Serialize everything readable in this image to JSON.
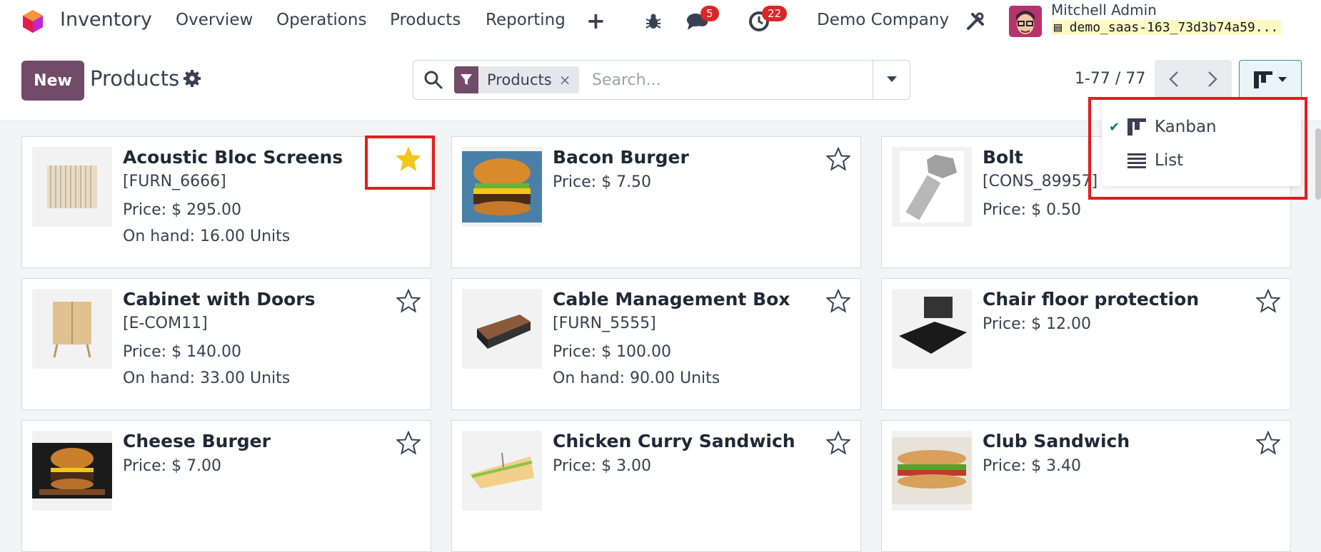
{
  "navbar": {
    "app_name": "Inventory",
    "menus": [
      "Overview",
      "Operations",
      "Products",
      "Reporting"
    ],
    "messages_count": "5",
    "activities_count": "22",
    "company": "Demo Company",
    "user_name": "Mitchell Admin",
    "database": "demo_saas-163_73d3b74a59..."
  },
  "control": {
    "new_label": "New",
    "title": "Products",
    "facet_label": "Products",
    "facet_remove": "×",
    "search_placeholder": "Search...",
    "pager": "1-77 / 77"
  },
  "view_switcher": {
    "items": [
      {
        "label": "Kanban",
        "checked": true,
        "icon": "kanban-icon"
      },
      {
        "label": "List",
        "checked": false,
        "icon": "list-icon"
      }
    ]
  },
  "products": [
    {
      "name": "Acoustic Bloc Screens",
      "ref": "[FURN_6666]",
      "price": "Price: $ 295.00",
      "on_hand": "On hand: 16.00 Units",
      "favorite": true,
      "image": "acoustic-screen-image"
    },
    {
      "name": "Bacon Burger",
      "ref": "",
      "price": "Price: $ 7.50",
      "on_hand": "",
      "favorite": false,
      "image": "burger-image"
    },
    {
      "name": "Bolt",
      "ref": "[CONS_89957]",
      "price": "Price: $ 0.50",
      "on_hand": "",
      "favorite": false,
      "image": "bolt-image"
    },
    {
      "name": "Cabinet with Doors",
      "ref": "[E-COM11]",
      "price": "Price: $ 140.00",
      "on_hand": "On hand: 33.00 Units",
      "favorite": false,
      "image": "cabinet-image"
    },
    {
      "name": "Cable Management Box",
      "ref": "[FURN_5555]",
      "price": "Price: $ 100.00",
      "on_hand": "On hand: 90.00 Units",
      "favorite": false,
      "image": "cable-box-image"
    },
    {
      "name": "Chair floor protection",
      "ref": "",
      "price": "Price: $ 12.00",
      "on_hand": "",
      "favorite": false,
      "image": "floor-mat-image"
    },
    {
      "name": "Cheese Burger",
      "ref": "",
      "price": "Price: $ 7.00",
      "on_hand": "",
      "favorite": false,
      "image": "cheese-burger-image"
    },
    {
      "name": "Chicken Curry Sandwich",
      "ref": "",
      "price": "Price: $ 3.00",
      "on_hand": "",
      "favorite": false,
      "image": "sandwich-image"
    },
    {
      "name": "Club Sandwich",
      "ref": "",
      "price": "Price: $ 3.40",
      "on_hand": "",
      "favorite": false,
      "image": "club-sandwich-image"
    }
  ],
  "colors": {
    "brand": "#714b67",
    "badge": "#dc2626",
    "star_active": "#f5c518",
    "highlight": "#e11d1d"
  }
}
